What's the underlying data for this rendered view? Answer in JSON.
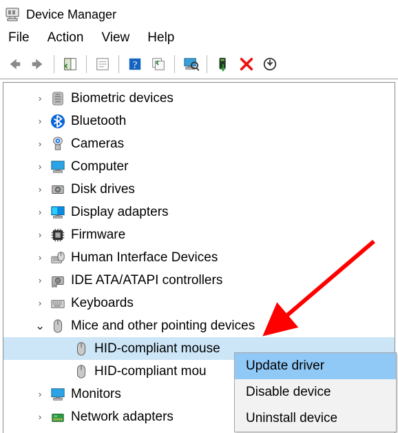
{
  "window": {
    "title": "Device Manager"
  },
  "menu": {
    "file": "File",
    "action": "Action",
    "view": "View",
    "help": "Help"
  },
  "tree": {
    "items": [
      {
        "label": "Biometric devices",
        "icon": "fingerprint"
      },
      {
        "label": "Bluetooth",
        "icon": "bluetooth"
      },
      {
        "label": "Cameras",
        "icon": "camera"
      },
      {
        "label": "Computer",
        "icon": "monitor"
      },
      {
        "label": "Disk drives",
        "icon": "disk"
      },
      {
        "label": "Display adapters",
        "icon": "display"
      },
      {
        "label": "Firmware",
        "icon": "chip"
      },
      {
        "label": "Human Interface Devices",
        "icon": "hid"
      },
      {
        "label": "IDE ATA/ATAPI controllers",
        "icon": "ide"
      },
      {
        "label": "Keyboards",
        "icon": "keyboard"
      },
      {
        "label": "Mice and other pointing devices",
        "icon": "mouse",
        "expanded": true
      },
      {
        "label": "Monitors",
        "icon": "monitor2"
      },
      {
        "label": "Network adapters",
        "icon": "network"
      }
    ],
    "mouse_children": [
      {
        "label": "HID-compliant mouse",
        "selected": true
      },
      {
        "label": "HID-compliant mou"
      }
    ]
  },
  "context": {
    "items": [
      {
        "label": "Update driver",
        "highlight": true
      },
      {
        "label": "Disable device"
      },
      {
        "label": "Uninstall device"
      }
    ]
  }
}
